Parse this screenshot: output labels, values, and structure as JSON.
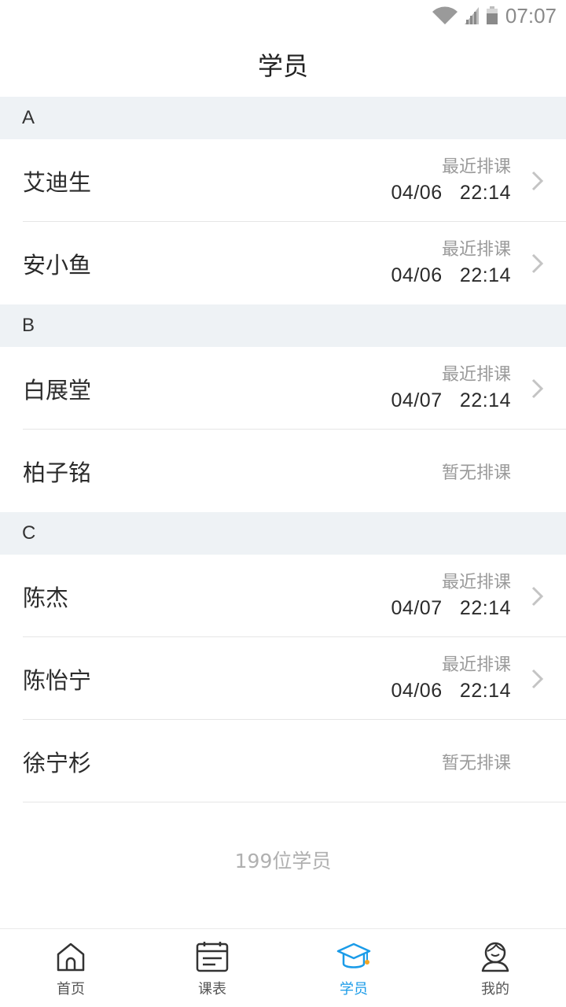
{
  "status_bar": {
    "time": "07:07"
  },
  "header": {
    "title": "学员"
  },
  "sections": [
    {
      "letter": "A",
      "students": [
        {
          "name": "艾迪生",
          "label": "最近排课",
          "date": "04/06   22:14"
        },
        {
          "name": "安小鱼",
          "label": "最近排课",
          "date": "04/06   22:14"
        }
      ]
    },
    {
      "letter": "B",
      "students": [
        {
          "name": "白展堂",
          "label": "最近排课",
          "date": "04/07   22:14"
        },
        {
          "name": "柏子铭",
          "none": "暂无排课"
        }
      ]
    },
    {
      "letter": "C",
      "students": [
        {
          "name": "陈杰",
          "label": "最近排课",
          "date": "04/07   22:14"
        },
        {
          "name": "陈怡宁",
          "label": "最近排课",
          "date": "04/06   22:14"
        },
        {
          "name": "徐宁杉",
          "none": "暂无排课"
        }
      ]
    }
  ],
  "footer": {
    "count": "199位学员"
  },
  "tabbar": {
    "tabs": [
      {
        "label": "首页",
        "icon": "home-icon"
      },
      {
        "label": "课表",
        "icon": "schedule-icon"
      },
      {
        "label": "学员",
        "icon": "graduation-cap-icon",
        "active": true
      },
      {
        "label": "我的",
        "icon": "profile-icon"
      }
    ],
    "active_color": "#1a9be8",
    "badge_color": "#f5a623"
  }
}
